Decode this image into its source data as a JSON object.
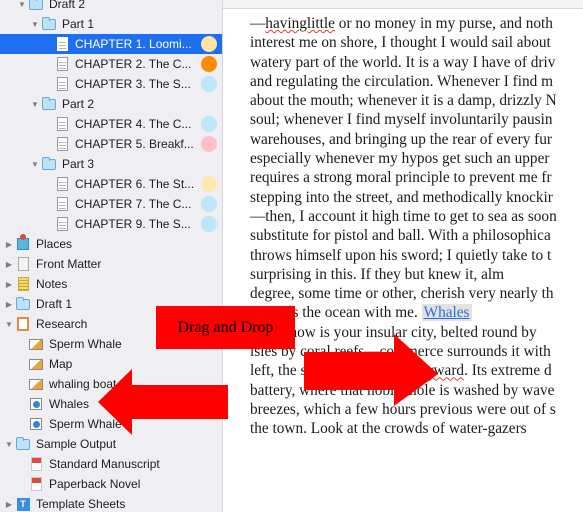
{
  "binder": {
    "items": [
      {
        "label": "Draft 2",
        "icon": "folder-icon",
        "disclosure": "expanded",
        "level": 1,
        "label_color": null
      },
      {
        "label": "Part 1",
        "icon": "folder-icon",
        "disclosure": "expanded",
        "level": 2
      },
      {
        "label": "CHAPTER 1. Loomi...",
        "icon": "document-icon",
        "level": 3,
        "selected": true,
        "label_color": "#ffe4a3"
      },
      {
        "label": "CHAPTER 2. The C...",
        "icon": "document-icon",
        "level": 3,
        "label_color": "#ff8c00"
      },
      {
        "label": "CHAPTER 3. The S...",
        "icon": "document-icon",
        "level": 3,
        "label_color": "#bde6fb"
      },
      {
        "label": "Part 2",
        "icon": "folder-icon",
        "disclosure": "expanded",
        "level": 2
      },
      {
        "label": "CHAPTER 4. The C...",
        "icon": "document-icon",
        "level": 3,
        "label_color": "#bde6fb"
      },
      {
        "label": "CHAPTER 5. Breakf...",
        "icon": "document-icon",
        "level": 3,
        "label_color": "#ffc0cb"
      },
      {
        "label": "Part 3",
        "icon": "folder-icon",
        "disclosure": "expanded",
        "level": 2
      },
      {
        "label": "CHAPTER 6. The St...",
        "icon": "document-icon",
        "level": 3,
        "label_color": "#ffe8ad"
      },
      {
        "label": "CHAPTER 7. The C...",
        "icon": "document-icon",
        "level": 3,
        "label_color": "#bde6fb"
      },
      {
        "label": "CHAPTER 9. The S...",
        "icon": "document-icon",
        "level": 3,
        "label_color": "#bde6fb"
      },
      {
        "label": "Places",
        "icon": "places-icon",
        "disclosure": "collapsed",
        "level": 0
      },
      {
        "label": "Front Matter",
        "icon": "front-matter-icon",
        "disclosure": "collapsed",
        "level": 0
      },
      {
        "label": "Notes",
        "icon": "notes-icon",
        "disclosure": "collapsed",
        "level": 0
      },
      {
        "label": "Draft 1",
        "icon": "folder-icon",
        "disclosure": "collapsed",
        "level": 0
      },
      {
        "label": "Research",
        "icon": "research-icon",
        "disclosure": "expanded",
        "level": 0
      },
      {
        "label": "Sperm Whale",
        "icon": "image-icon",
        "level": 1
      },
      {
        "label": "Map",
        "icon": "image-icon",
        "level": 1
      },
      {
        "label": "whaling boat",
        "icon": "image-icon",
        "level": 1
      },
      {
        "label": "Whales",
        "icon": "webpage-icon",
        "level": 1
      },
      {
        "label": "Sperm Whale",
        "icon": "webpage-icon",
        "level": 1
      },
      {
        "label": "Sample Output",
        "icon": "folder-icon",
        "disclosure": "expanded",
        "level": 0
      },
      {
        "label": "Standard Manuscript",
        "icon": "pdf-icon",
        "level": 1
      },
      {
        "label": "Paperback Novel",
        "icon": "pdf-icon",
        "level": 1
      },
      {
        "label": "Template Sheets",
        "icon": "template-icon",
        "disclosure": "collapsed",
        "level": 0
      }
    ]
  },
  "editor": {
    "lines": [
      [
        "—",
        {
          "sq": "havinglittle"
        },
        " or no money in my purse, and noth"
      ],
      [
        "interest me on shore, I thought I would sail about"
      ],
      [
        "watery part of the world. It is a way I have of driv"
      ],
      [
        "and regulating the circulation. Whenever I find m"
      ],
      [
        "about the mouth; whenever it is a damp, drizzly N"
      ],
      [
        "soul; whenever I find myself involuntarily pausin"
      ],
      [
        "warehouses, and bringing up the rear of every fur"
      ],
      [
        "especially whenever my hypos get such an upper"
      ],
      [
        "requires a strong moral principle to prevent me fr"
      ],
      [
        "stepping into the street, and methodically knockir"
      ],
      [
        "—then, I account it high time to get to sea as soon"
      ],
      [
        "substitute for pistol and ball. With a philosophica"
      ],
      [
        "throws himself upon his sword; I quietly take to t"
      ],
      [
        "surprising in this. If they but knew it, alm"
      ],
      [
        "degree, some time or other, cherish very nearly th"
      ],
      [
        "towards the ocean with me. ",
        {
          "link": "Whales"
        }
      ],
      [
        "    There now is your insular city, belted round by"
      ],
      [
        "isles by coral reefs—commerce surrounds it with "
      ],
      [
        "left, the streets take you ",
        {
          "sq": "waterward"
        },
        ". Its extreme d"
      ],
      [
        "battery, where that noble mole is washed by wave"
      ],
      [
        "breezes, which a few hours previous were out of s"
      ],
      [
        "the town. Look at the crowds of water-gazers"
      ]
    ]
  },
  "annotation": {
    "callout_label": "Drag and Drop",
    "arrow_color": "#ff0000"
  }
}
